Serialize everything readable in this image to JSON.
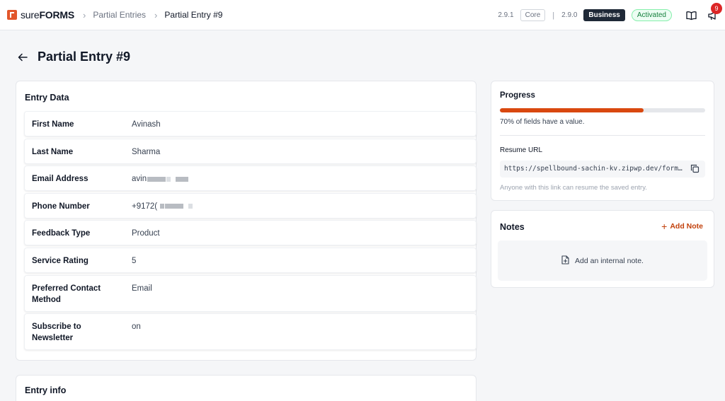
{
  "header": {
    "logo_sure": "SURE",
    "logo_forms": "FORMS",
    "breadcrumbs": [
      "Partial Entries",
      "Partial Entry #9"
    ],
    "version_core": "2.9.1",
    "core_label": "Core",
    "version_pro": "2.9.0",
    "plan_label": "Business",
    "status_label": "Activated",
    "notification_count": "9"
  },
  "page": {
    "title": "Partial Entry #9"
  },
  "entry_data": {
    "title": "Entry Data",
    "fields": [
      {
        "label": "First Name",
        "value": "Avinash"
      },
      {
        "label": "Last Name",
        "value": "Sharma"
      },
      {
        "label": "Email Address",
        "value": "avin"
      },
      {
        "label": "Phone Number",
        "value": "+9172("
      },
      {
        "label": "Feedback Type",
        "value": "Product"
      },
      {
        "label": "Service Rating",
        "value": "5"
      },
      {
        "label": "Preferred Contact Method",
        "value": "Email"
      },
      {
        "label": "Subscribe to Newsletter",
        "value": "on"
      }
    ]
  },
  "entry_info": {
    "title": "Entry info"
  },
  "progress": {
    "title": "Progress",
    "fraction": 0.7,
    "note": "70% of fields have a value.",
    "resume_url_label": "Resume URL",
    "resume_url": "https://spellbound-sachin-kv.zipwp.dev/form…",
    "resume_note": "Anyone with this link can resume the saved entry.",
    "accent_color": "#d9480f"
  },
  "notes": {
    "title": "Notes",
    "add_label": "Add Note",
    "empty_text": "Add an internal note."
  }
}
